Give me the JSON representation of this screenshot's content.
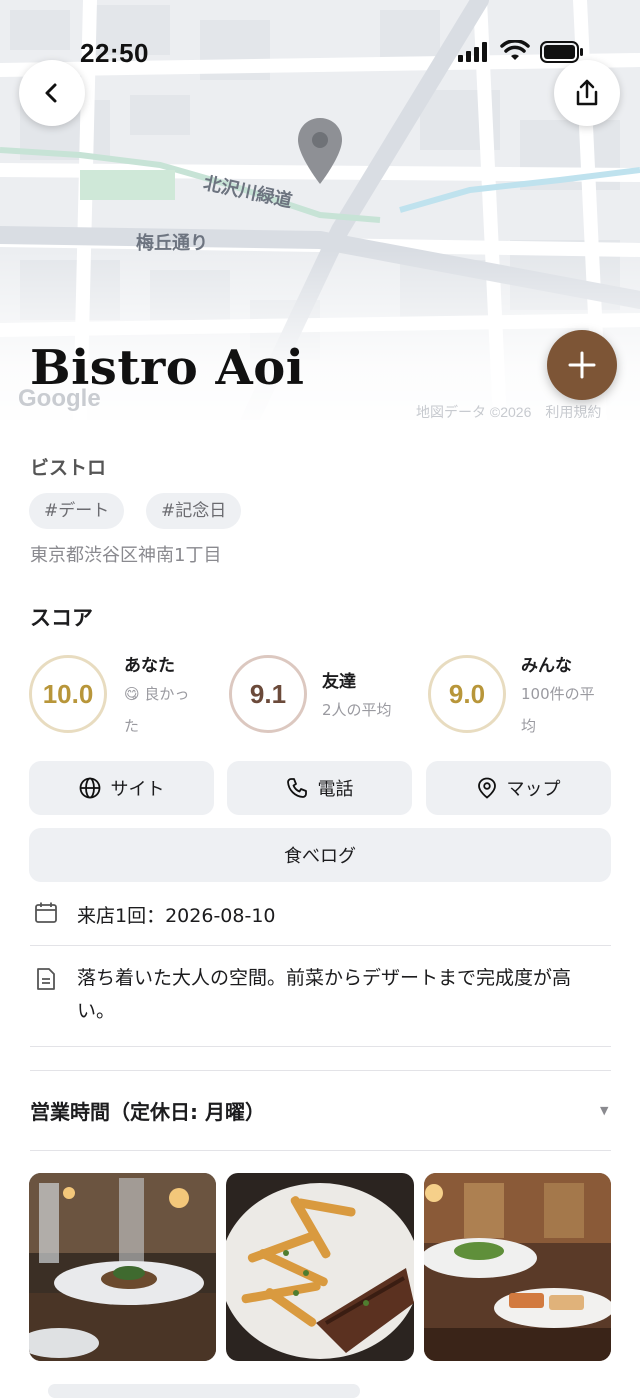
{
  "status_bar": {
    "time": "22:50"
  },
  "map": {
    "labels": {
      "street": "梅丘通り",
      "greenway": "北沢川緑道"
    },
    "attribution": "Google",
    "credit": "地図データ ©2026　利用規約"
  },
  "restaurant": {
    "name": "Bistro Aoi",
    "category": "ビストロ",
    "tags": [
      "#デート",
      "#記念日"
    ],
    "address": "東京都渋谷区神南1丁目"
  },
  "scores": {
    "heading": "スコア",
    "you": {
      "label": "あなた",
      "value": "10.0",
      "emoji": "😋",
      "line1": "良かっ",
      "line2": "た"
    },
    "friends": {
      "label": "友達",
      "value": "9.1",
      "sub": "2人の平均"
    },
    "everyone": {
      "label": "みんな",
      "value": "9.0",
      "line1": "100件の平",
      "line2": "均"
    }
  },
  "actions": {
    "site": "サイト",
    "phone": "電話",
    "map": "マップ",
    "tabelog": "食べログ"
  },
  "visit": {
    "text": "来店1回：2026-08-10"
  },
  "note": {
    "text": "落ち着いた大人の空間。前菜からデザートまで完成度が高い。"
  },
  "hours": {
    "label": "営業時間（定休日: 月曜）",
    "caret": "▼"
  },
  "colors": {
    "accent": "#7d5536",
    "ring_you": "#e8dcc0",
    "ring_friends": "#dcc8c0",
    "ring_everyone": "#e8dcc0",
    "value_you": "#b8963a",
    "value_friends": "#6b4a3a",
    "value_everyone": "#b8963a"
  },
  "icons": [
    "back-chevron-icon",
    "share-icon",
    "plus-icon",
    "globe-icon",
    "phone-icon",
    "map-pin-icon",
    "calendar-icon",
    "note-icon",
    "location-pin-icon"
  ]
}
